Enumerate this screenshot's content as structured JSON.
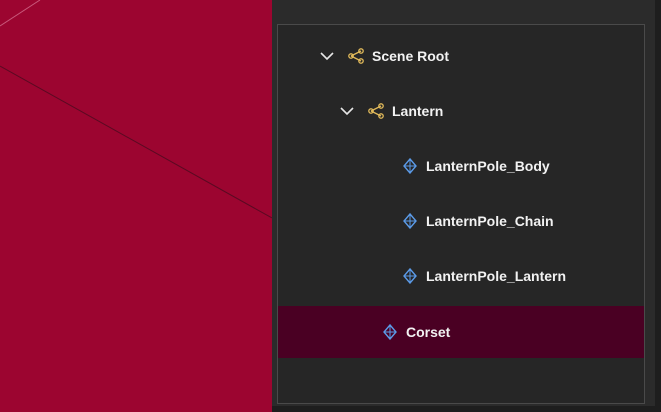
{
  "scene_tree": {
    "nodes": [
      {
        "label": "Scene Root",
        "icon": "scene-node-icon",
        "expanded": true,
        "depth": 0,
        "selected": false
      },
      {
        "label": "Lantern",
        "icon": "scene-node-icon",
        "expanded": true,
        "depth": 1,
        "selected": false
      },
      {
        "label": "LanternPole_Body",
        "icon": "mesh-icon",
        "depth": 2,
        "selected": false
      },
      {
        "label": "LanternPole_Chain",
        "icon": "mesh-icon",
        "depth": 2,
        "selected": false
      },
      {
        "label": "LanternPole_Lantern",
        "icon": "mesh-icon",
        "depth": 2,
        "selected": false
      },
      {
        "label": "Corset",
        "icon": "mesh-icon",
        "depth": 1,
        "selected": true
      }
    ]
  },
  "colors": {
    "viewport_bg": "#9c0530",
    "panel_bg": "#2b2b2b",
    "selected_row": "#4a0023",
    "node_icon": "#e0b95a",
    "mesh_icon": "#5b9be8"
  }
}
